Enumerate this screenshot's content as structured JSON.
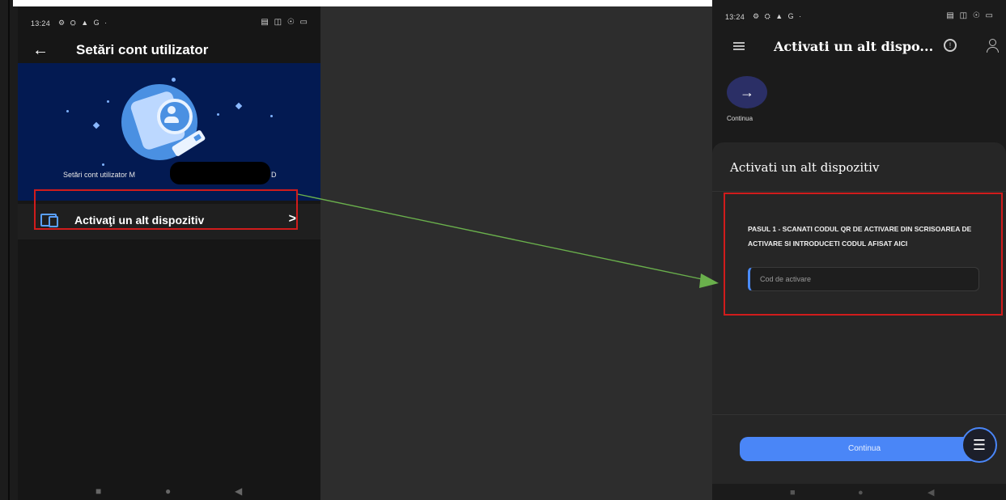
{
  "left_phone": {
    "status": {
      "time": "13:24",
      "left_icons": "⚙ ⛭ ▲ G ·",
      "right_icons": "▤ ◫ ☉ ▭"
    },
    "title": "Setări cont utilizator",
    "hero": {
      "caption_start": "Setări cont utilizator M",
      "caption_end": "D"
    },
    "menu_item": {
      "label": "Activaţi un alt dispozitiv",
      "chevron": ">"
    },
    "nav": {
      "home": "■",
      "circle": "●",
      "back": "◀"
    }
  },
  "right_phone": {
    "status": {
      "time": "13:24",
      "left_icons": "⚙ ⛭ ▲ G ·",
      "right_icons": "▤ ◫ ☉ ▭"
    },
    "title": "Activati un alt dispo...",
    "alert_glyph": "!",
    "continue_circle": {
      "glyph": "→",
      "label": "Continua"
    },
    "sheet": {
      "title": "Activati un alt dispozitiv",
      "step": "PASUL 1 - SCANATI CODUL QR DE ACTIVARE DIN SCRISOAREA DE ACTIVARE SI INTRODUCETI CODUL AFISAT AICI",
      "input_placeholder": "Cod de activare",
      "input_value": ""
    },
    "primary_button": "Continua",
    "fab_glyph": "☰",
    "nav": {
      "home": "■",
      "circle": "●",
      "back": "◀"
    }
  },
  "colors": {
    "highlight": "#d01c1c",
    "arrow": "#6ab04c",
    "accent": "#4a86f7",
    "hero_bg": "#031a52"
  }
}
